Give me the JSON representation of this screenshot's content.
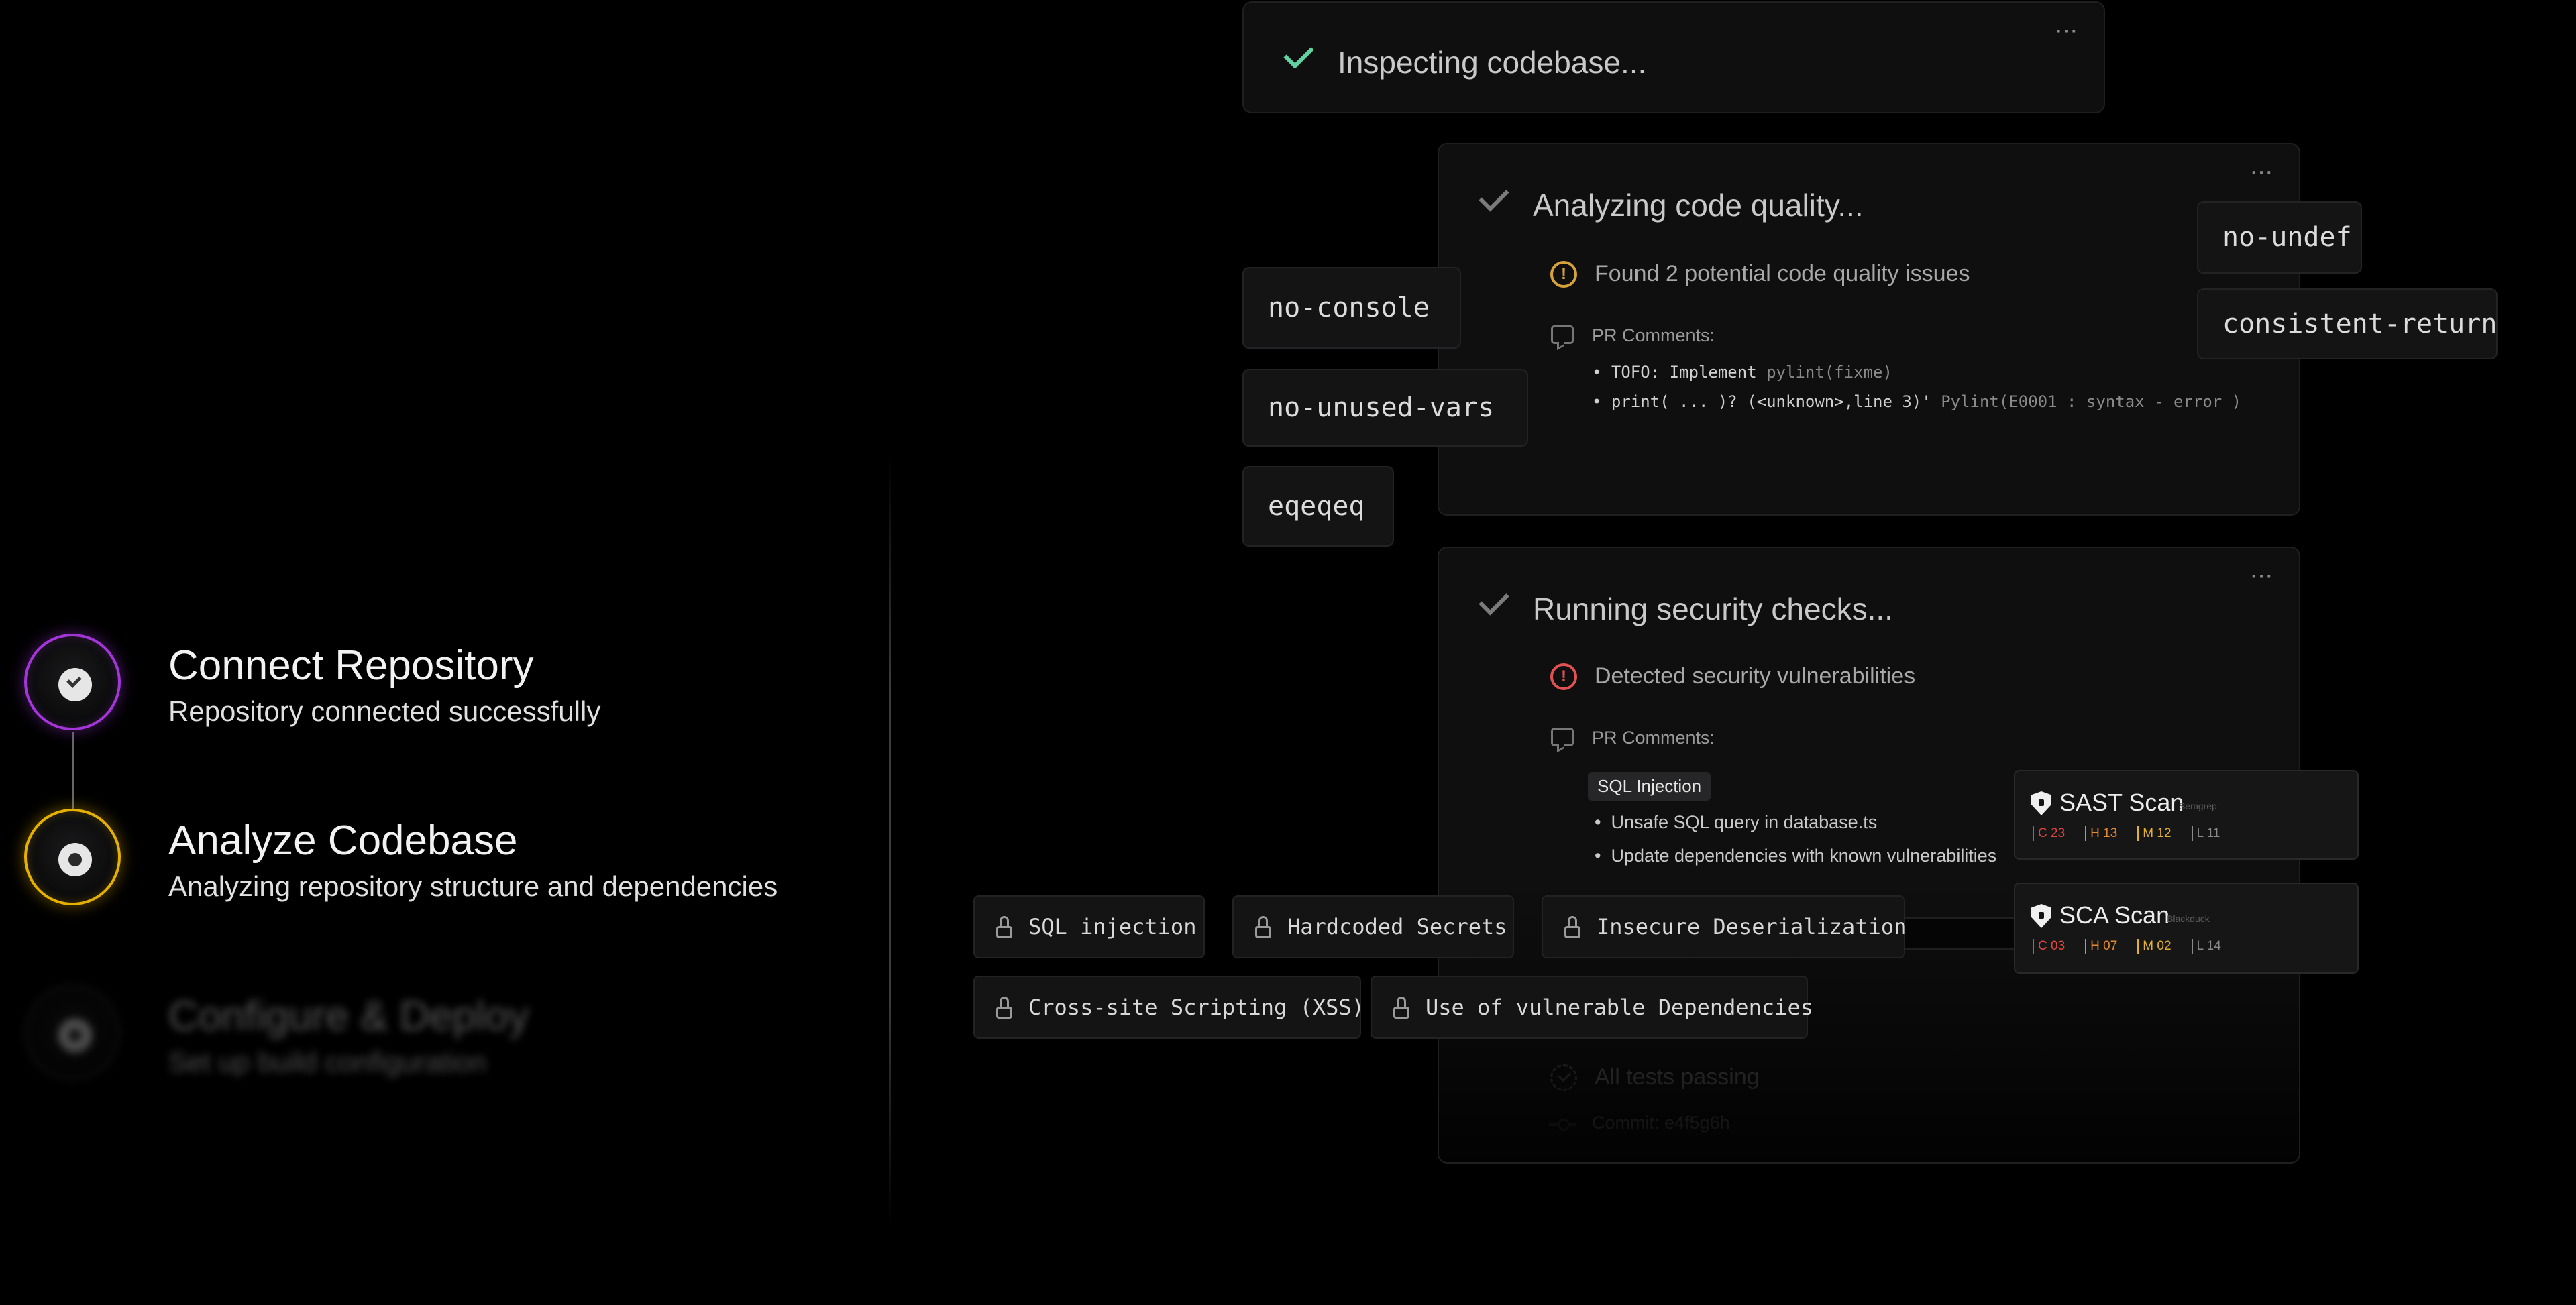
{
  "steps": [
    {
      "title": "Connect Repository",
      "subtitle": "Repository connected successfully",
      "state": "complete",
      "accent": "#a436d8"
    },
    {
      "title": "Analyze Codebase",
      "subtitle": "Analyzing repository structure and dependencies",
      "state": "active",
      "accent": "#e5b000"
    },
    {
      "title": "Configure & Deploy",
      "subtitle": "Set up build configuration",
      "state": "pending"
    }
  ],
  "inspect": {
    "title": "Inspecting codebase...",
    "menu": "···"
  },
  "quality": {
    "title": "Analyzing code quality...",
    "menu": "···",
    "finding": "Found 2 potential code quality issues",
    "pr_label": "PR Comments:",
    "comments": [
      {
        "bullet": "•",
        "code": "TOFO: Implement",
        "detail": "pylint(fixme)"
      },
      {
        "bullet": "•",
        "code": "print( ... )? (<unknown>,line 3)'",
        "detail": "Pylint(E0001 : syntax - error )"
      }
    ]
  },
  "security": {
    "title": "Running security checks...",
    "menu": "···",
    "finding": "Detected security vulnerabilities",
    "pr_label": "PR Comments:",
    "tag": "SQL Injection",
    "items": [
      "Unsafe SQL query in database.ts",
      "Update dependencies with known vulnerabilities"
    ],
    "tests": "All tests passing",
    "commit": "Commit: e4f5g6h"
  },
  "lint_rules": [
    "no-console",
    "no-unused-vars",
    "eqeqeq",
    "no-undef",
    "consistent-return"
  ],
  "vulnerabilities": [
    "SQL injection",
    "Hardcoded Secrets",
    "Insecure Deserialization",
    "Cross-site Scripting (XSS)",
    "Use of vulnerable Dependencies"
  ],
  "scans": [
    {
      "title": "SAST Scan",
      "source": "Semgrep",
      "stats": {
        "critical": "C 23",
        "high": "H 13",
        "medium": "M 12",
        "low": "L 11"
      }
    },
    {
      "title": "SCA Scan",
      "source": "Blackduck",
      "stats": {
        "critical": "C 03",
        "high": "H 07",
        "medium": "M 02",
        "low": "L 14"
      }
    }
  ],
  "colors": {
    "success": "#5fd3a2",
    "warning": "#d8a23a",
    "error": "#e05252",
    "critical": "#e0473f",
    "high": "#e6892f",
    "medium": "#e3b12f"
  }
}
